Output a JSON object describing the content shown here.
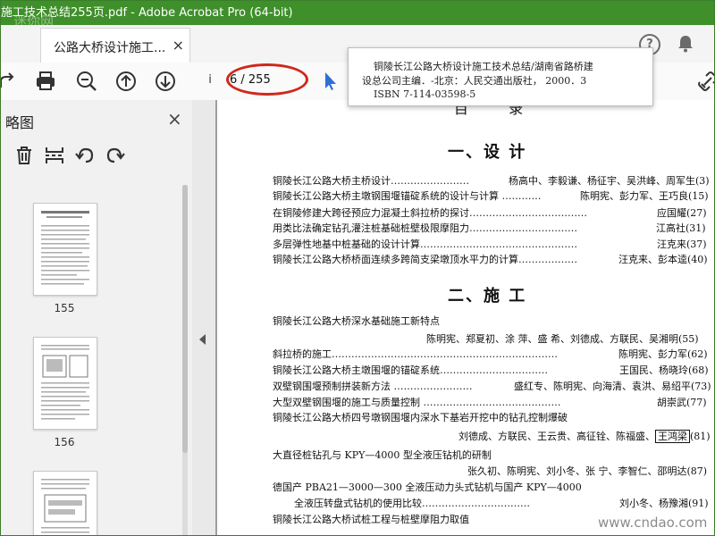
{
  "window": {
    "title": "施工技术总结255页.pdf - Adobe Acrobat Pro (64-bit)",
    "watermark_top": "迷你网"
  },
  "tabs": [
    {
      "label": "公路大桥设计施工...",
      "close": "×"
    }
  ],
  "header": {
    "help": "?"
  },
  "toolbar": {
    "page_input": "i",
    "page_count": "6 / 255"
  },
  "sidebar": {
    "title": "略图",
    "close": "×",
    "thumbnails": [
      {
        "num": "155"
      },
      {
        "num": "156"
      }
    ]
  },
  "popup": {
    "line1": "铜陵长江公路大桥设计施工技术总结/湖南省路桥建",
    "line2": "设总公司主编．-北京：人民交通出版社， 2000．3",
    "line3": "ISBN 7-114-03598-5"
  },
  "page": {
    "header": "目  录",
    "section1": "一、设    计",
    "section2": "二、施    工",
    "entries1": [
      {
        "title": "铜陵长江公路大桥主桥设计……………………",
        "authors": "杨高中、李毅谦、杨征宇、吴洪峰、周军生(3)"
      },
      {
        "title": "铜陵长江公路大桥主墩钢围堰锚碇系统的设计与计算 …………",
        "authors": "陈明宪、彭力军、王巧良(15)"
      },
      {
        "title": "在铜陵修建大跨径预应力混凝土斜拉桥的探讨………………………………",
        "authors": "应国耀(27)"
      },
      {
        "title": "用类比法确定钻孔灌注桩基础桩壁极限摩阻力……………………………",
        "authors": "江高社(31)"
      },
      {
        "title": "多层弹性地基中桩基础的设计计算…………………………………………",
        "authors": "汪克来(37)"
      },
      {
        "title": "铜陵长江公路大桥桥面连续多跨简支梁墩顶水平力的计算………………",
        "authors": "汪克来、彭本逵(40)"
      }
    ],
    "entries2": [
      {
        "title": "铜陵长江公路大桥深水基础施工新特点",
        "authors": "陈明宪、郑夏初、涂  萍、盛  希、刘德成、方联民、吴湘明(55)"
      },
      {
        "title": "斜拉桥的施工……………………………………………………………",
        "authors": "陈明宪、彭力军(62)"
      },
      {
        "title": "铜陵长江公路大桥主墩围堰的锚碇系统……………………………",
        "authors": "王国民、杨晓玲(68)"
      },
      {
        "title": "双壁钢围堰预制拼装新方法 ……………………",
        "authors": "盛红专、陈明宪、向海清、袁洪、易绍平(73)"
      },
      {
        "title": "大型双壁钢围堰的施工与质量控制 ……………………………………",
        "authors": "胡崇武(77)"
      },
      {
        "title": "铜陵长江公路大桥四号墩钢围堰内深水下基岩开挖中的钻孔控制爆破",
        "authors_prefix": "刘德成、方联民、王云贵、高征铨、陈福盛、",
        "authors_boxed": "王鸿梁",
        "authors_suffix": "(81)"
      },
      {
        "title": "大直径桩钻孔与 KPY—4000 型全液压钻机的研制",
        "authors": "张久初、陈明宪、刘小冬、张  宁、李智仁、邵明达(87)"
      },
      {
        "title": "德国产 PBA21—3000—300 全液压动力头式钻机与国产 KPY—4000",
        "sub": "全液压转盘式钻机的使用比较……………………………",
        "authors": "刘小冬、杨豫湘(91)"
      },
      {
        "title": "铜陵长江公路大桥试桩工程与桩壁摩阻力取值"
      }
    ],
    "watermark_bottom": "www.cndao.com"
  },
  "colors": {
    "titlebar": "#3f8f2b",
    "highlight_ellipse": "#d0271b",
    "cursor": "#2f6fd6"
  }
}
